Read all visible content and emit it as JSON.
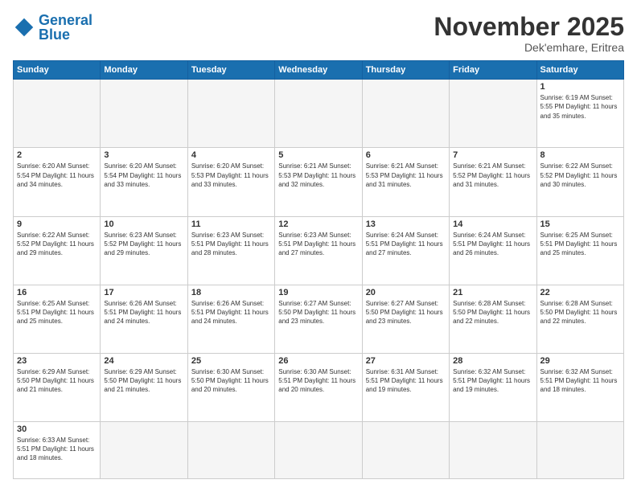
{
  "logo": {
    "general": "General",
    "blue": "Blue"
  },
  "header": {
    "month": "November 2025",
    "location": "Dek'emhare, Eritrea"
  },
  "days_of_week": [
    "Sunday",
    "Monday",
    "Tuesday",
    "Wednesday",
    "Thursday",
    "Friday",
    "Saturday"
  ],
  "weeks": [
    [
      {
        "day": "",
        "info": ""
      },
      {
        "day": "",
        "info": ""
      },
      {
        "day": "",
        "info": ""
      },
      {
        "day": "",
        "info": ""
      },
      {
        "day": "",
        "info": ""
      },
      {
        "day": "",
        "info": ""
      },
      {
        "day": "1",
        "info": "Sunrise: 6:19 AM\nSunset: 5:55 PM\nDaylight: 11 hours\nand 35 minutes."
      }
    ],
    [
      {
        "day": "2",
        "info": "Sunrise: 6:20 AM\nSunset: 5:54 PM\nDaylight: 11 hours\nand 34 minutes."
      },
      {
        "day": "3",
        "info": "Sunrise: 6:20 AM\nSunset: 5:54 PM\nDaylight: 11 hours\nand 33 minutes."
      },
      {
        "day": "4",
        "info": "Sunrise: 6:20 AM\nSunset: 5:53 PM\nDaylight: 11 hours\nand 33 minutes."
      },
      {
        "day": "5",
        "info": "Sunrise: 6:21 AM\nSunset: 5:53 PM\nDaylight: 11 hours\nand 32 minutes."
      },
      {
        "day": "6",
        "info": "Sunrise: 6:21 AM\nSunset: 5:53 PM\nDaylight: 11 hours\nand 31 minutes."
      },
      {
        "day": "7",
        "info": "Sunrise: 6:21 AM\nSunset: 5:52 PM\nDaylight: 11 hours\nand 31 minutes."
      },
      {
        "day": "8",
        "info": "Sunrise: 6:22 AM\nSunset: 5:52 PM\nDaylight: 11 hours\nand 30 minutes."
      }
    ],
    [
      {
        "day": "9",
        "info": "Sunrise: 6:22 AM\nSunset: 5:52 PM\nDaylight: 11 hours\nand 29 minutes."
      },
      {
        "day": "10",
        "info": "Sunrise: 6:23 AM\nSunset: 5:52 PM\nDaylight: 11 hours\nand 29 minutes."
      },
      {
        "day": "11",
        "info": "Sunrise: 6:23 AM\nSunset: 5:51 PM\nDaylight: 11 hours\nand 28 minutes."
      },
      {
        "day": "12",
        "info": "Sunrise: 6:23 AM\nSunset: 5:51 PM\nDaylight: 11 hours\nand 27 minutes."
      },
      {
        "day": "13",
        "info": "Sunrise: 6:24 AM\nSunset: 5:51 PM\nDaylight: 11 hours\nand 27 minutes."
      },
      {
        "day": "14",
        "info": "Sunrise: 6:24 AM\nSunset: 5:51 PM\nDaylight: 11 hours\nand 26 minutes."
      },
      {
        "day": "15",
        "info": "Sunrise: 6:25 AM\nSunset: 5:51 PM\nDaylight: 11 hours\nand 25 minutes."
      }
    ],
    [
      {
        "day": "16",
        "info": "Sunrise: 6:25 AM\nSunset: 5:51 PM\nDaylight: 11 hours\nand 25 minutes."
      },
      {
        "day": "17",
        "info": "Sunrise: 6:26 AM\nSunset: 5:51 PM\nDaylight: 11 hours\nand 24 minutes."
      },
      {
        "day": "18",
        "info": "Sunrise: 6:26 AM\nSunset: 5:51 PM\nDaylight: 11 hours\nand 24 minutes."
      },
      {
        "day": "19",
        "info": "Sunrise: 6:27 AM\nSunset: 5:50 PM\nDaylight: 11 hours\nand 23 minutes."
      },
      {
        "day": "20",
        "info": "Sunrise: 6:27 AM\nSunset: 5:50 PM\nDaylight: 11 hours\nand 23 minutes."
      },
      {
        "day": "21",
        "info": "Sunrise: 6:28 AM\nSunset: 5:50 PM\nDaylight: 11 hours\nand 22 minutes."
      },
      {
        "day": "22",
        "info": "Sunrise: 6:28 AM\nSunset: 5:50 PM\nDaylight: 11 hours\nand 22 minutes."
      }
    ],
    [
      {
        "day": "23",
        "info": "Sunrise: 6:29 AM\nSunset: 5:50 PM\nDaylight: 11 hours\nand 21 minutes."
      },
      {
        "day": "24",
        "info": "Sunrise: 6:29 AM\nSunset: 5:50 PM\nDaylight: 11 hours\nand 21 minutes."
      },
      {
        "day": "25",
        "info": "Sunrise: 6:30 AM\nSunset: 5:50 PM\nDaylight: 11 hours\nand 20 minutes."
      },
      {
        "day": "26",
        "info": "Sunrise: 6:30 AM\nSunset: 5:51 PM\nDaylight: 11 hours\nand 20 minutes."
      },
      {
        "day": "27",
        "info": "Sunrise: 6:31 AM\nSunset: 5:51 PM\nDaylight: 11 hours\nand 19 minutes."
      },
      {
        "day": "28",
        "info": "Sunrise: 6:32 AM\nSunset: 5:51 PM\nDaylight: 11 hours\nand 19 minutes."
      },
      {
        "day": "29",
        "info": "Sunrise: 6:32 AM\nSunset: 5:51 PM\nDaylight: 11 hours\nand 18 minutes."
      }
    ],
    [
      {
        "day": "30",
        "info": "Sunrise: 6:33 AM\nSunset: 5:51 PM\nDaylight: 11 hours\nand 18 minutes."
      },
      {
        "day": "",
        "info": ""
      },
      {
        "day": "",
        "info": ""
      },
      {
        "day": "",
        "info": ""
      },
      {
        "day": "",
        "info": ""
      },
      {
        "day": "",
        "info": ""
      },
      {
        "day": "",
        "info": ""
      }
    ]
  ]
}
